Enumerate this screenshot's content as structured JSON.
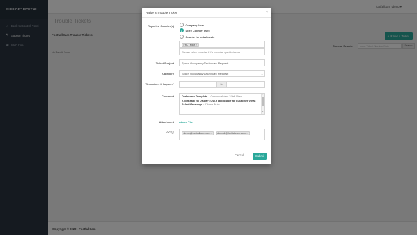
{
  "sidebar": {
    "brand": "SUPPORT PORTAL",
    "items": [
      {
        "label": "Back to Control Panel",
        "icon": "home-icon",
        "glyph": "⌂"
      },
      {
        "label": "Support Ticket",
        "icon": "ticket-icon",
        "glyph": "✎"
      },
      {
        "label": "Web Cam",
        "icon": "chart-icon",
        "glyph": "▦"
      }
    ]
  },
  "topbar": {
    "user": "footfallcam_demo ▾"
  },
  "main": {
    "title": "Trouble Tickets",
    "section_title": "FootfallCam Trouble Tickets",
    "raise_button": "+ Raise a Ticket",
    "general_search_label": "General Search:",
    "search_placeholder": "Input Ticket Number/Sub",
    "search_button": "Search",
    "no_result": "No Result Found"
  },
  "footer": {
    "text": "Copyright © 2020 - FootfallCam"
  },
  "modal": {
    "title": "Raise a Trouble Ticket",
    "close": "×",
    "reported_label": "Reported Counter(s)",
    "options": [
      {
        "label": "Company level",
        "checked": false
      },
      {
        "label": "Site / Counter level",
        "checked": true
      },
      {
        "label": "Counter is not allocate",
        "checked": false
      }
    ],
    "counter_tag": "FFC_Mike",
    "counter_placeholder": "Please select counter if it's counter specific issue",
    "subject_label": "Ticket Subject",
    "subject_value": "Space Occupancy Dashboard Request",
    "category_label": "Category",
    "category_value": "Space Occupancy Dashboard Request",
    "when_label": "When does it happen?",
    "to_label": "to",
    "comment_label": "Comment",
    "comment": {
      "line1_bold": "Dashboard Template",
      "line1_rest": " – Customer View / Staff View",
      "line2_bold": "2. Message to Display (ONLY applicable for Customer View)",
      "line3_bold": "Default Message",
      "line3_rest": " – Please Enter"
    },
    "attachment_label": "Attachment",
    "attach_link": "Attach File",
    "cc_label": "CC",
    "cc_tags": [
      "demo@footfallcam.com",
      "demo1@footfallcam.com"
    ],
    "cancel": "Cancel",
    "submit": "Submit"
  },
  "colors": {
    "accent": "#2aa89a",
    "sidebar": "#2b3541"
  }
}
